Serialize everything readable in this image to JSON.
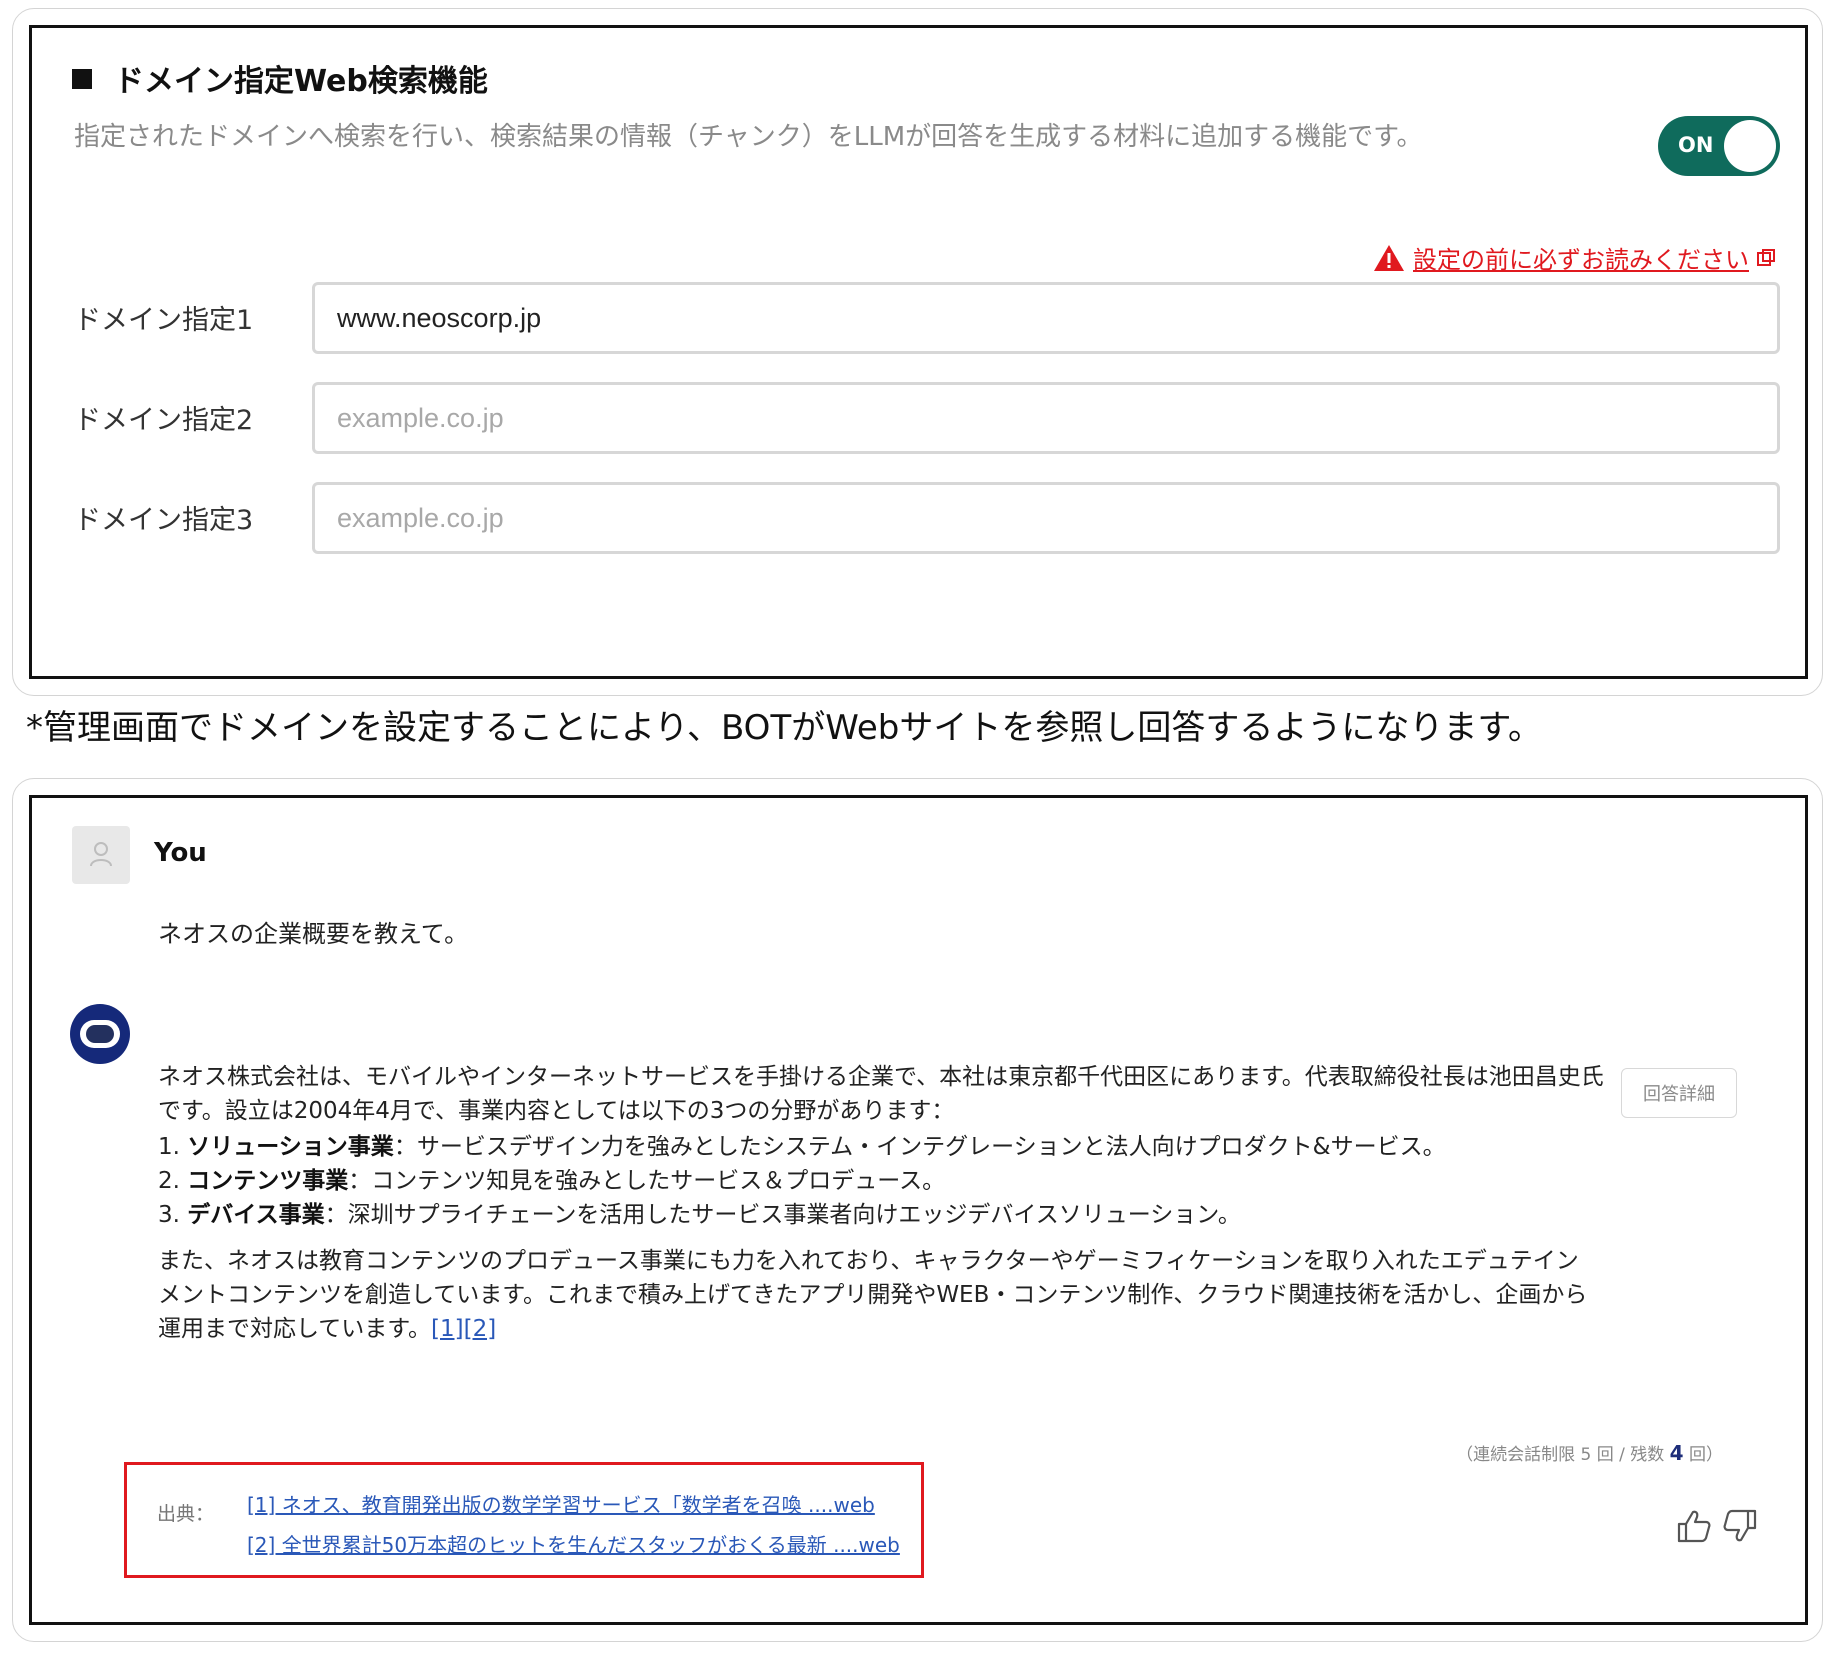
{
  "settings": {
    "title": "ドメイン指定Web検索機能",
    "description": "指定されたドメインへ検索を行い、検索結果の情報（チャンク）をLLMが回答を生成する材料に追加する機能です。",
    "toggle_label": "ON",
    "toggle_state": "on",
    "warning_link": "設定の前に必ずお読みください",
    "domains": [
      {
        "label": "ドメイン指定1",
        "value": "www.neoscorp.jp",
        "placeholder": "example.co.jp"
      },
      {
        "label": "ドメイン指定2",
        "value": "",
        "placeholder": "example.co.jp"
      },
      {
        "label": "ドメイン指定3",
        "value": "",
        "placeholder": "example.co.jp"
      }
    ]
  },
  "caption": "*管理画面でドメインを設定することにより、BOTがWebサイトを参照し回答するようになります。",
  "chat": {
    "user_name": "You",
    "question": "ネオスの企業概要を教えて。",
    "answer_intro": "ネオス株式会社は、モバイルやインターネットサービスを手掛ける企業で、本社は東京都千代田区にあります。代表取締役社長は池田昌史氏です。設立は2004年4月で、事業内容としては以下の3つの分野があります：",
    "answer_items": [
      {
        "num": "1.",
        "title": "ソリューション事業",
        "text": "：サービスデザイン力を強みとしたシステム・インテグレーションと法人向けプロダクト&サービス。"
      },
      {
        "num": "2.",
        "title": "コンテンツ事業",
        "text": "：コンテンツ知見を強みとしたサービス＆プロデュース。"
      },
      {
        "num": "3.",
        "title": "デバイス事業",
        "text": "：深圳サプライチェーンを活用したサービス事業者向けエッジデバイスソリューション。"
      }
    ],
    "answer_outro": "また、ネオスは教育コンテンツのプロデュース事業にも力を入れており、キャラクターやゲーミフィケーションを取り入れたエデュテインメントコンテンツを創造しています。これまで積み上げてきたアプリ開発やWEB・コンテンツ制作、クラウド関連技術を活かし、企画から運用まで対応しています。",
    "refs": "[1][2]",
    "detail_button": "回答詳細",
    "limit_prefix": "（連続会話制限 5 回 / 残数 ",
    "limit_remaining": "4",
    "limit_suffix": " 回）",
    "sources_label": "出典：",
    "sources": [
      "[1] ネオス、教育開発出版の数学学習サービス「数学者を召喚 ....web",
      "[2] 全世界累計50万本超のヒットを生んだスタッフがおくる最新 ....web"
    ]
  },
  "colors": {
    "toggle_on": "#0f6b5c",
    "warning": "#e0191f",
    "link": "#2a58b8",
    "highlight_border": "#e0191f"
  }
}
